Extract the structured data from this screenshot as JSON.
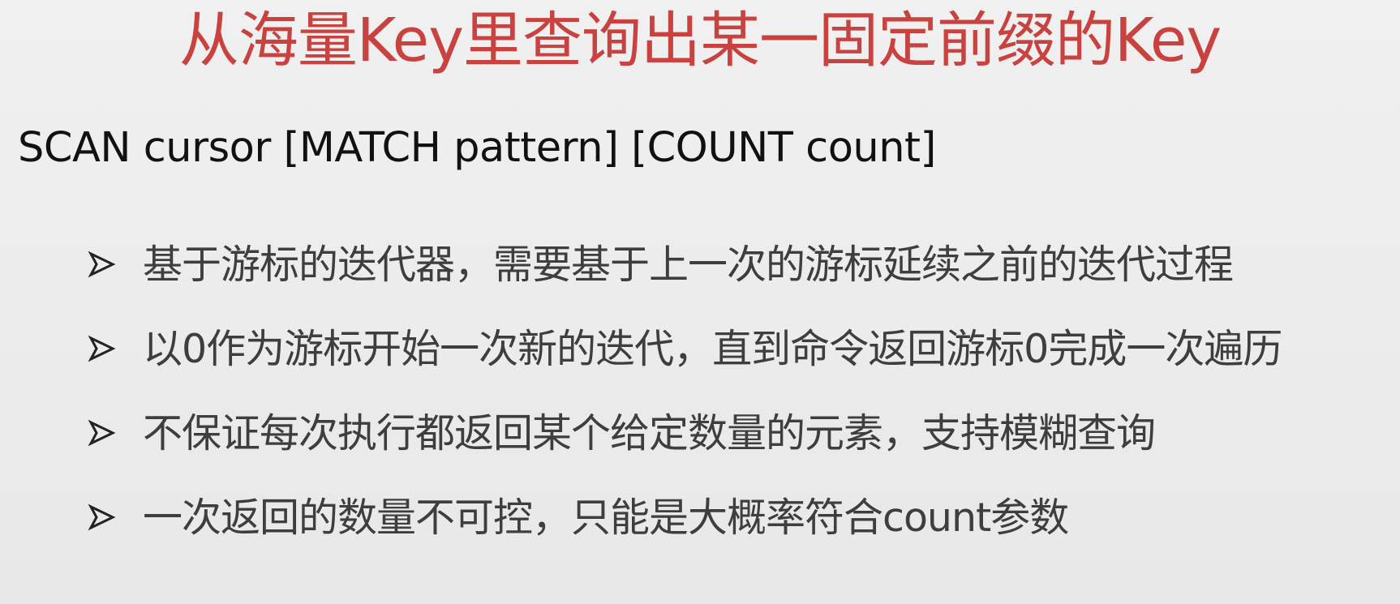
{
  "slide": {
    "title": "从海量Key里查询出某一固定前缀的Key",
    "command": "SCAN cursor [MATCH pattern] [COUNT count]",
    "bullets": [
      {
        "text": "基于游标的迭代器，需要基于上一次的游标延续之前的迭代过程",
        "marker_icon": "arrowhead-bullet-icon"
      },
      {
        "text": "以0作为游标开始一次新的迭代，直到命令返回游标0完成一次遍历",
        "marker_icon": "arrowhead-bullet-icon"
      },
      {
        "text": "不保证每次执行都返回某个给定数量的元素，支持模糊查询",
        "marker_icon": "arrowhead-bullet-icon"
      },
      {
        "text": "一次返回的数量不可控，只能是大概率符合count参数",
        "marker_icon": "arrowhead-bullet-icon"
      }
    ]
  },
  "colors": {
    "title": "#c8423f",
    "command": "#111111",
    "bullet_text": "#3e3e3e",
    "background": "#ececec"
  }
}
